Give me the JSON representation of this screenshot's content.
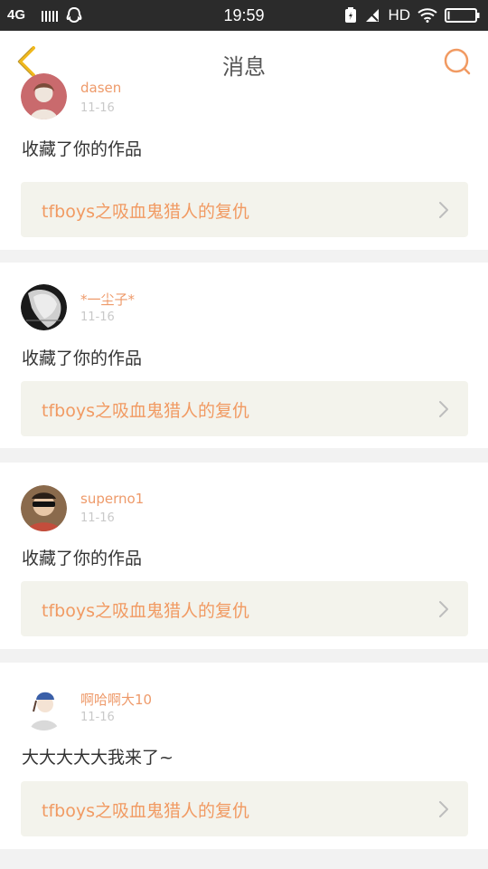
{
  "status_bar": {
    "network": "4G",
    "time": "19:59",
    "hd": "HD"
  },
  "header": {
    "title": "消息"
  },
  "colors": {
    "accent": "#f19a62",
    "back_arrow": "#f0b81c",
    "card_link_bg": "#f3f3ec"
  },
  "notifications": [
    {
      "username": "dasen",
      "date": "11-16",
      "message": "收藏了你的作品",
      "work_title": "tfboys之吸血鬼猎人的复仇"
    },
    {
      "username": "*一尘子*",
      "date": "11-16",
      "message": "收藏了你的作品",
      "work_title": "tfboys之吸血鬼猎人的复仇"
    },
    {
      "username": "superno1",
      "date": "11-16",
      "message": "收藏了你的作品",
      "work_title": "tfboys之吸血鬼猎人的复仇"
    },
    {
      "username": "啊哈啊大10",
      "date": "11-16",
      "message": "大大大大大我来了~",
      "work_title": "tfboys之吸血鬼猎人的复仇"
    }
  ]
}
